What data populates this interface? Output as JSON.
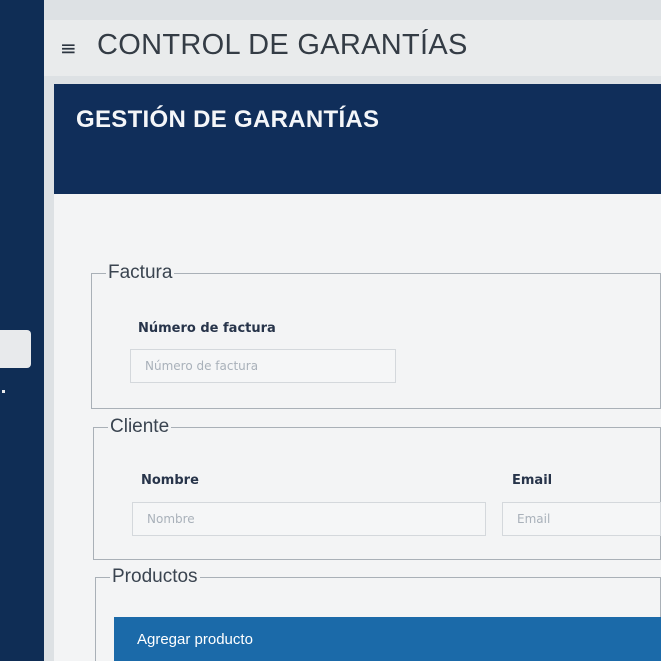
{
  "header": {
    "app_title": "CONTROL DE GARANTÍAS",
    "menu_icon": "hamburger-menu-icon"
  },
  "panel": {
    "title": "GESTIÓN DE GARANTÍAS"
  },
  "factura": {
    "legend": "Factura",
    "numero_label": "Número de factura",
    "numero_placeholder": "Número de factura",
    "numero_value": ""
  },
  "cliente": {
    "legend": "Cliente",
    "nombre_label": "Nombre",
    "nombre_placeholder": "Nombre",
    "nombre_value": "",
    "email_label": "Email",
    "email_placeholder": "Email",
    "email_value": ""
  },
  "productos": {
    "legend": "Productos",
    "add_button_label": "Agregar producto"
  },
  "colors": {
    "sidebar": "#0f2d55",
    "header_panel": "#102e5a",
    "primary_button": "#1b6aa9"
  }
}
